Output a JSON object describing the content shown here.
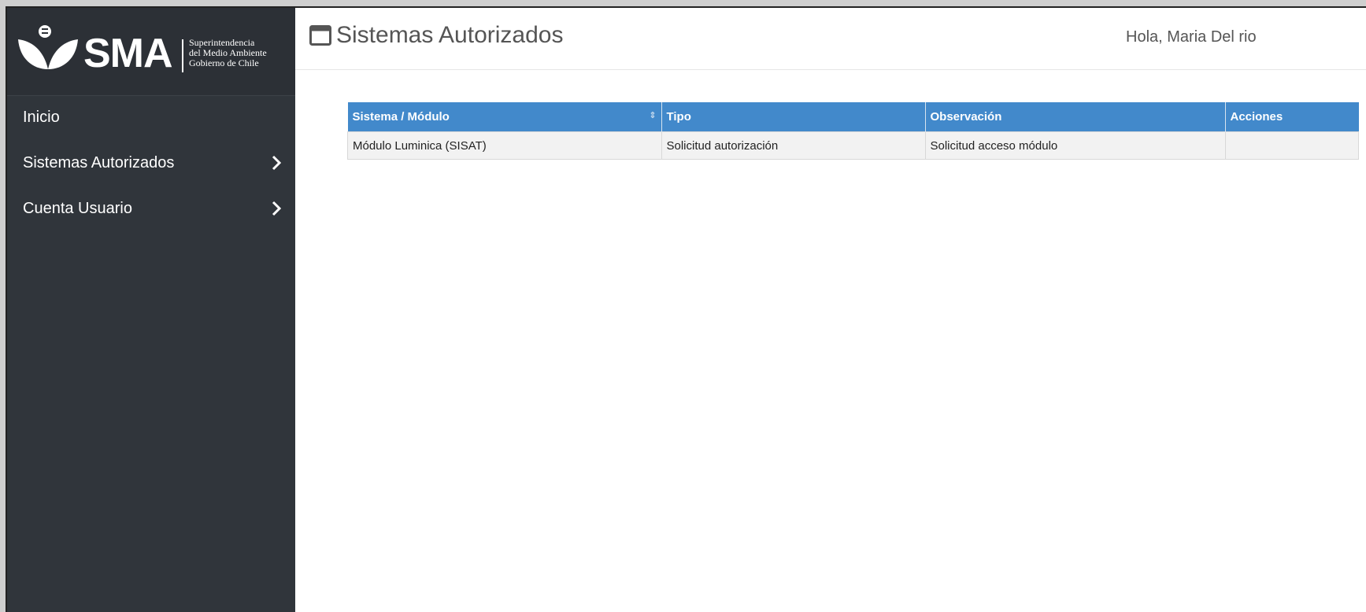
{
  "brand": {
    "name": "SMA",
    "subtitle_line1": "Superintendencia",
    "subtitle_line2": "del Medio Ambiente",
    "subtitle_line3": "Gobierno de Chile"
  },
  "sidebar": {
    "items": [
      {
        "label": "Inicio",
        "icon": ""
      },
      {
        "label": "Sistemas Autorizados",
        "icon": "chevron-right-icon"
      },
      {
        "label": "Cuenta Usuario",
        "icon": "chevron-right-icon"
      }
    ]
  },
  "header": {
    "title": "Sistemas Autorizados",
    "title_icon": "window-icon",
    "greeting": "Hola, Maria Del rio"
  },
  "table": {
    "columns": [
      "Sistema / Módulo",
      "Tipo",
      "Observación",
      "Acciones"
    ],
    "rows": [
      [
        "Módulo Luminica (SISAT)",
        "Solicitud autorización",
        "Solicitud acceso módulo",
        ""
      ]
    ]
  },
  "colors": {
    "sidebar_bg": "#30353b",
    "table_header": "#4289cb"
  }
}
